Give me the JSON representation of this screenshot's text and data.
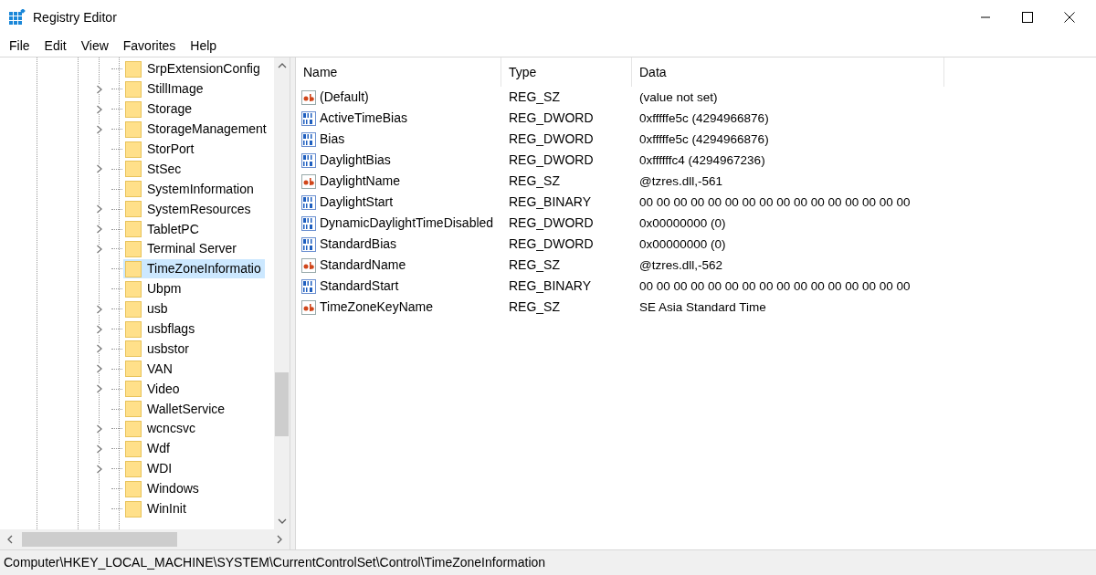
{
  "window": {
    "title": "Registry Editor"
  },
  "menu": [
    "File",
    "Edit",
    "View",
    "Favorites",
    "Help"
  ],
  "tree": {
    "items": [
      {
        "label": "SrpExtensionConfig",
        "expandable": false,
        "selected": false
      },
      {
        "label": "StillImage",
        "expandable": true,
        "selected": false
      },
      {
        "label": "Storage",
        "expandable": true,
        "selected": false
      },
      {
        "label": "StorageManagement",
        "expandable": true,
        "selected": false
      },
      {
        "label": "StorPort",
        "expandable": false,
        "selected": false
      },
      {
        "label": "StSec",
        "expandable": true,
        "selected": false
      },
      {
        "label": "SystemInformation",
        "expandable": false,
        "selected": false
      },
      {
        "label": "SystemResources",
        "expandable": true,
        "selected": false
      },
      {
        "label": "TabletPC",
        "expandable": true,
        "selected": false
      },
      {
        "label": "Terminal Server",
        "expandable": true,
        "selected": false
      },
      {
        "label": "TimeZoneInformatio",
        "expandable": false,
        "selected": true
      },
      {
        "label": "Ubpm",
        "expandable": false,
        "selected": false
      },
      {
        "label": "usb",
        "expandable": true,
        "selected": false
      },
      {
        "label": "usbflags",
        "expandable": true,
        "selected": false
      },
      {
        "label": "usbstor",
        "expandable": true,
        "selected": false
      },
      {
        "label": "VAN",
        "expandable": true,
        "selected": false
      },
      {
        "label": "Video",
        "expandable": true,
        "selected": false
      },
      {
        "label": "WalletService",
        "expandable": false,
        "selected": false
      },
      {
        "label": "wcncsvc",
        "expandable": true,
        "selected": false
      },
      {
        "label": "Wdf",
        "expandable": true,
        "selected": false
      },
      {
        "label": "WDI",
        "expandable": true,
        "selected": false
      },
      {
        "label": "Windows",
        "expandable": false,
        "selected": false
      },
      {
        "label": "WinInit",
        "expandable": false,
        "selected": false
      }
    ]
  },
  "values": {
    "columns": [
      "Name",
      "Type",
      "Data"
    ],
    "rows": [
      {
        "kind": "string",
        "name": "(Default)",
        "type": "REG_SZ",
        "data": "(value not set)"
      },
      {
        "kind": "binary",
        "name": "ActiveTimeBias",
        "type": "REG_DWORD",
        "data": "0xfffffe5c (4294966876)"
      },
      {
        "kind": "binary",
        "name": "Bias",
        "type": "REG_DWORD",
        "data": "0xfffffe5c (4294966876)"
      },
      {
        "kind": "binary",
        "name": "DaylightBias",
        "type": "REG_DWORD",
        "data": "0xffffffc4 (4294967236)"
      },
      {
        "kind": "string",
        "name": "DaylightName",
        "type": "REG_SZ",
        "data": "@tzres.dll,-561"
      },
      {
        "kind": "binary",
        "name": "DaylightStart",
        "type": "REG_BINARY",
        "data": "00 00 00 00 00 00 00 00 00 00 00 00 00 00 00 00"
      },
      {
        "kind": "binary",
        "name": "DynamicDaylightTimeDisabled",
        "type": "REG_DWORD",
        "data": "0x00000000 (0)"
      },
      {
        "kind": "binary",
        "name": "StandardBias",
        "type": "REG_DWORD",
        "data": "0x00000000 (0)"
      },
      {
        "kind": "string",
        "name": "StandardName",
        "type": "REG_SZ",
        "data": "@tzres.dll,-562"
      },
      {
        "kind": "binary",
        "name": "StandardStart",
        "type": "REG_BINARY",
        "data": "00 00 00 00 00 00 00 00 00 00 00 00 00 00 00 00"
      },
      {
        "kind": "string",
        "name": "TimeZoneKeyName",
        "type": "REG_SZ",
        "data": "SE Asia Standard Time"
      }
    ]
  },
  "status_bar": "Computer\\HKEY_LOCAL_MACHINE\\SYSTEM\\CurrentControlSet\\Control\\TimeZoneInformation"
}
